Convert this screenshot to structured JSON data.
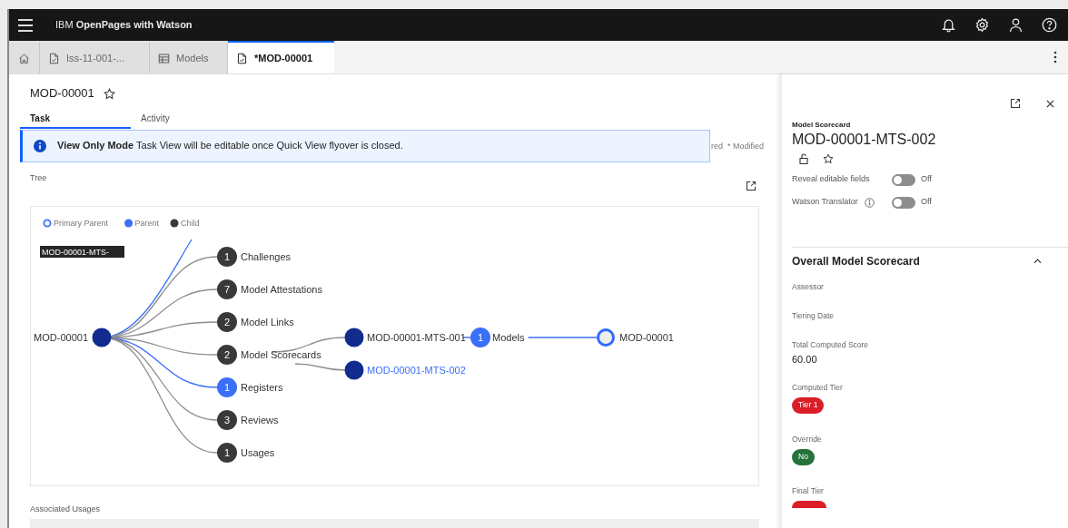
{
  "header": {
    "title": "IBM **OpenPages with Watson**"
  },
  "tabs": [
    {
      "kind": "home",
      "selected": false
    },
    {
      "kind": "document",
      "label": "Iss-11-001-...",
      "selected": false
    },
    {
      "kind": "table",
      "label": "Models",
      "selected": false
    },
    {
      "kind": "document",
      "label": "*MOD-00001",
      "selected": true
    }
  ],
  "record": {
    "title": "MOD-00001"
  },
  "view_tabs": [
    {
      "label": "Task",
      "selected": true
    },
    {
      "label": "Activity",
      "selected": false
    }
  ],
  "banner": {
    "title": "View Only Mode",
    "message": "Task View will be editable once Quick View flyover is closed."
  },
  "legend_partial": [
    "red",
    "* Modified"
  ],
  "tree": {
    "title": "Tree",
    "legend": [
      {
        "kind": "primary",
        "label": "Primary Parent"
      },
      {
        "kind": "parent",
        "label": "Parent"
      },
      {
        "kind": "child",
        "label": "Child"
      }
    ],
    "tooltip": "MOD-00001-MTS-",
    "root": {
      "label": "MOD-00001",
      "kind": "record",
      "children": [
        {
          "count": "1",
          "label": "Challenges",
          "kind": "child"
        },
        {
          "count": "7",
          "label": "Model Attestations",
          "kind": "child"
        },
        {
          "count": "2",
          "label": "Model Links",
          "kind": "child"
        },
        {
          "count": "2",
          "label": "Model Scorecards",
          "kind": "child",
          "children": [
            {
              "label": "MOD-00001-MTS-001",
              "kind": "record",
              "selected": false,
              "children": [
                {
                  "count": "1",
                  "label": "Models",
                  "kind": "parent",
                  "children": [
                    {
                      "label": "MOD-00001",
                      "kind": "primary"
                    }
                  ]
                }
              ]
            },
            {
              "label": "MOD-00001-MTS-002",
              "kind": "record",
              "selected": true
            }
          ]
        },
        {
          "count": "1",
          "label": "Registers",
          "kind": "parent"
        },
        {
          "count": "3",
          "label": "Reviews",
          "kind": "child"
        },
        {
          "count": "1",
          "label": "Usages",
          "kind": "child"
        }
      ]
    }
  },
  "associated_usages": {
    "title": "Associated Usages"
  },
  "panel": {
    "subtitle": "Model Scorecard",
    "title": "MOD-00001-MTS-002",
    "toggles": [
      {
        "label": "Reveal editable fields",
        "info": false,
        "on": false,
        "state_text": "Off"
      },
      {
        "label": "Watson Translator",
        "info": true,
        "on": false,
        "state_text": "Off"
      }
    ],
    "section": {
      "title": "Overall Model Scorecard",
      "expanded": true,
      "fields": [
        {
          "label": "Assessor"
        },
        {
          "label": "Tiering Date"
        },
        {
          "label": "Total Computed Score",
          "value": "60.00"
        },
        {
          "label": "Computed Tier",
          "tag": {
            "text": "Tier 1",
            "color": "#da1e28"
          }
        },
        {
          "label": "Override",
          "tag": {
            "text": "No",
            "color": "#24733a"
          }
        },
        {
          "label": "Final Tier",
          "tag": {
            "color": "#da1e28"
          }
        }
      ]
    }
  }
}
